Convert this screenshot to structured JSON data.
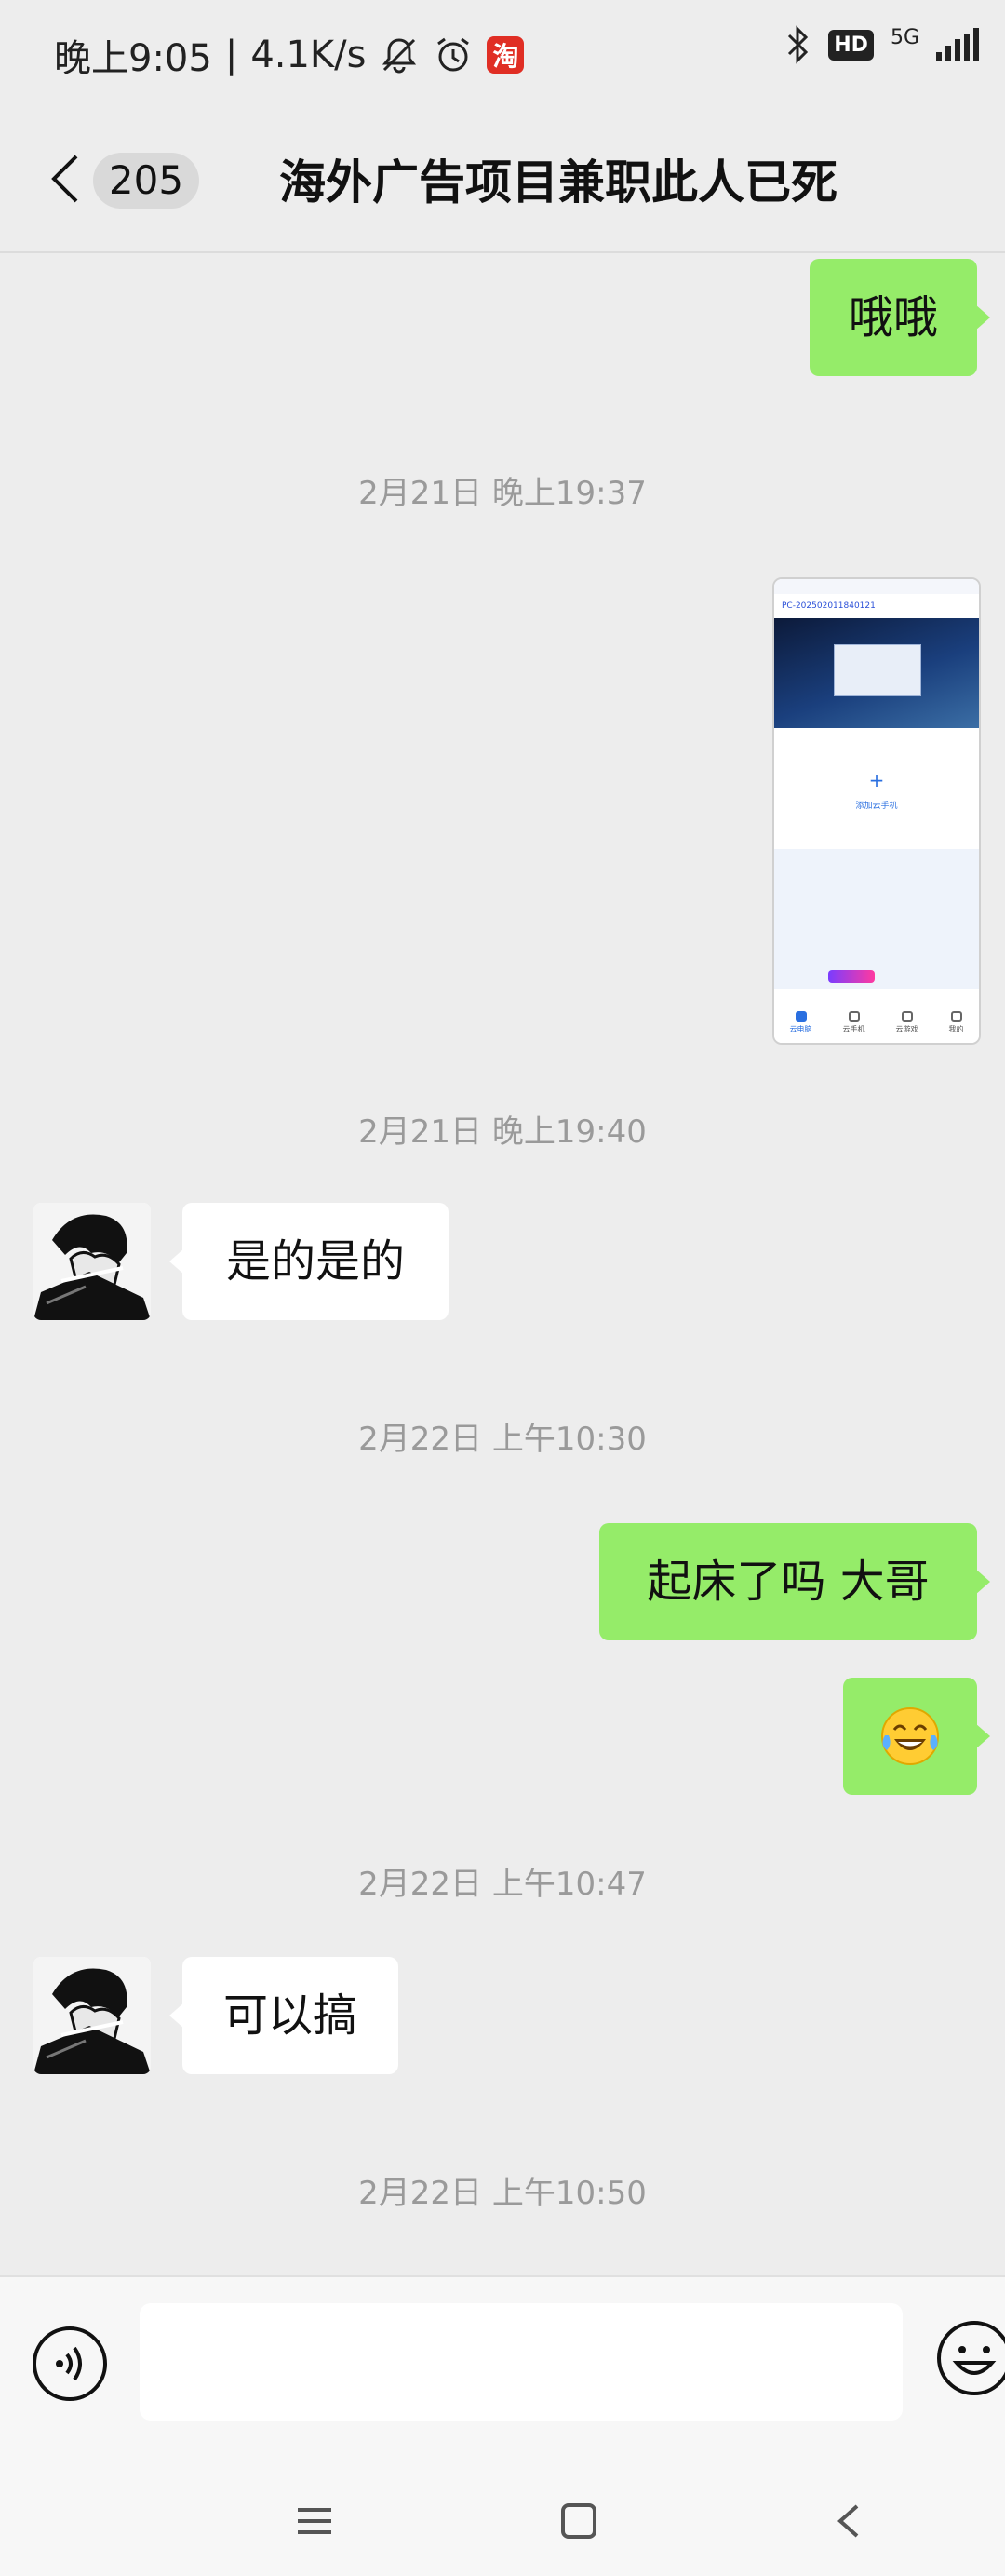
{
  "status_bar": {
    "time": "晚上9:05",
    "speed": "4.1K/s",
    "taobao_icon_char": "淘",
    "hd_label": "HD",
    "network": "5G",
    "icons": [
      "mute-bell-icon",
      "alarm-icon",
      "taobao-app-icon",
      "bluetooth-icon",
      "hd-voice-icon",
      "signal-icon"
    ]
  },
  "header": {
    "unread_count": "205",
    "title": "海外广告项目兼职此人已死"
  },
  "messages": [
    {
      "type": "text",
      "side": "out",
      "text": "哦哦"
    },
    {
      "type": "timestamp",
      "text": "2月21日 晚上19:37"
    },
    {
      "type": "image",
      "side": "out",
      "thumb": {
        "header_text": "PC-202502011840121",
        "plus": "+",
        "plus_label": "添加云手机",
        "tabs": [
          "云电脑",
          "云手机",
          "云游戏",
          "我的"
        ]
      }
    },
    {
      "type": "timestamp",
      "text": "2月21日 晚上19:40"
    },
    {
      "type": "text",
      "side": "in",
      "text": "是的是的"
    },
    {
      "type": "timestamp",
      "text": "2月22日 上午10:30"
    },
    {
      "type": "text",
      "side": "out",
      "text": "起床了吗 大哥"
    },
    {
      "type": "emoji",
      "side": "out",
      "emoji": "face-with-tears-of-joy"
    },
    {
      "type": "timestamp",
      "text": "2月22日 上午10:47"
    },
    {
      "type": "text",
      "side": "in",
      "text": "可以搞"
    },
    {
      "type": "timestamp",
      "text": "2月22日 上午10:50"
    }
  ],
  "input_bar": {
    "placeholder": "",
    "value": ""
  },
  "colors": {
    "background": "#ededed",
    "outgoing_bubble": "#95ec69",
    "incoming_bubble": "#ffffff",
    "timestamp": "#9a9a9a"
  }
}
